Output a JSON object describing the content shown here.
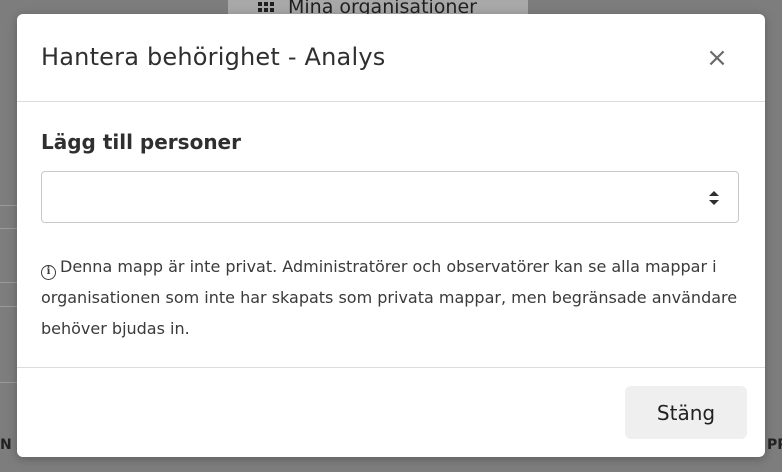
{
  "background": {
    "header_text": "Mina organisationer",
    "left_edge_text": "N",
    "right_edge_text": "PP"
  },
  "modal": {
    "title": "Hantera behörighet - Analys",
    "close_icon": "×",
    "add_people_label": "Lägg till personer",
    "select_value": "",
    "info_icon": "i",
    "info_text": "Denna mapp är inte privat. Administratörer och observatörer kan se alla mappar i organisationen som inte har skapats som privata mappar, men begränsade användare behöver bjudas in.",
    "footer_button": "Stäng"
  },
  "colors": {
    "backdrop": "#7d7d7d",
    "modal_bg": "#ffffff",
    "button_bg": "#efefef"
  }
}
